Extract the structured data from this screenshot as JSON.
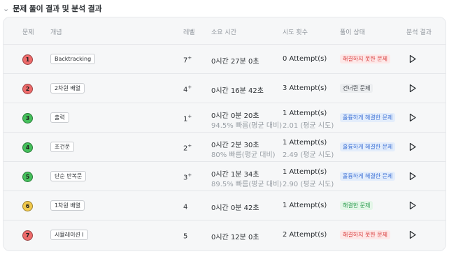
{
  "section": {
    "title": "문제 풀이 결과 및 분석 결과"
  },
  "columns": {
    "problem": "문제",
    "concept": "개념",
    "level": "레벨",
    "time": "소요 시간",
    "attempts": "시도 횟수",
    "status": "풀이 상태",
    "analysis": "분석 결과"
  },
  "rows": [
    {
      "number": "1",
      "color": "red",
      "concept": "Backtracking",
      "level": "7",
      "level_plus": "+",
      "time": "0시간 27분 0초",
      "time_sub": "",
      "attempts": "0 Attempt(s)",
      "attempts_sub": "",
      "status": "해결하지 못한 문제",
      "status_type": "red"
    },
    {
      "number": "2",
      "color": "red",
      "concept": "2차원 배열",
      "level": "4",
      "level_plus": "+",
      "time": "0시간 16분 42초",
      "time_sub": "",
      "attempts": "3 Attempt(s)",
      "attempts_sub": "",
      "status": "건너뛴 문제",
      "status_type": "gray"
    },
    {
      "number": "3",
      "color": "green",
      "concept": "출력",
      "level": "1",
      "level_plus": "+",
      "time": "0시간 0분 20초",
      "time_sub": "94.5% 빠름(평균 대비)",
      "attempts": "1 Attempt(s)",
      "attempts_sub": "2.01 (평균 시도)",
      "status": "훌륭하게 해결한 문제",
      "status_type": "blue"
    },
    {
      "number": "4",
      "color": "green",
      "concept": "조건문",
      "level": "2",
      "level_plus": "+",
      "time": "0시간 2분 30초",
      "time_sub": "80% 빠름(평균 대비)",
      "attempts": "1 Attempt(s)",
      "attempts_sub": "2.49 (평균 시도)",
      "status": "훌륭하게 해결한 문제",
      "status_type": "blue"
    },
    {
      "number": "5",
      "color": "green",
      "concept": "단순 반복문",
      "level": "3",
      "level_plus": "+",
      "time": "0시간 1분 34초",
      "time_sub": "89.5% 빠름(평균 대비)",
      "attempts": "1 Attempt(s)",
      "attempts_sub": "2.90 (평균 시도)",
      "status": "훌륭하게 해결한 문제",
      "status_type": "blue"
    },
    {
      "number": "6",
      "color": "yellow",
      "concept": "1차원 배열",
      "level": "4",
      "level_plus": "",
      "time": "0시간 0분 42초",
      "time_sub": "",
      "attempts": "1 Attempt(s)",
      "attempts_sub": "",
      "status": "해결한 문제",
      "status_type": "green"
    },
    {
      "number": "7",
      "color": "red",
      "concept": "시뮬레이션 I",
      "level": "5",
      "level_plus": "",
      "time": "0시간 12분 0초",
      "time_sub": "",
      "attempts": "2 Attempt(s)",
      "attempts_sub": "",
      "status": "해결하지 못한 문제",
      "status_type": "red"
    }
  ]
}
